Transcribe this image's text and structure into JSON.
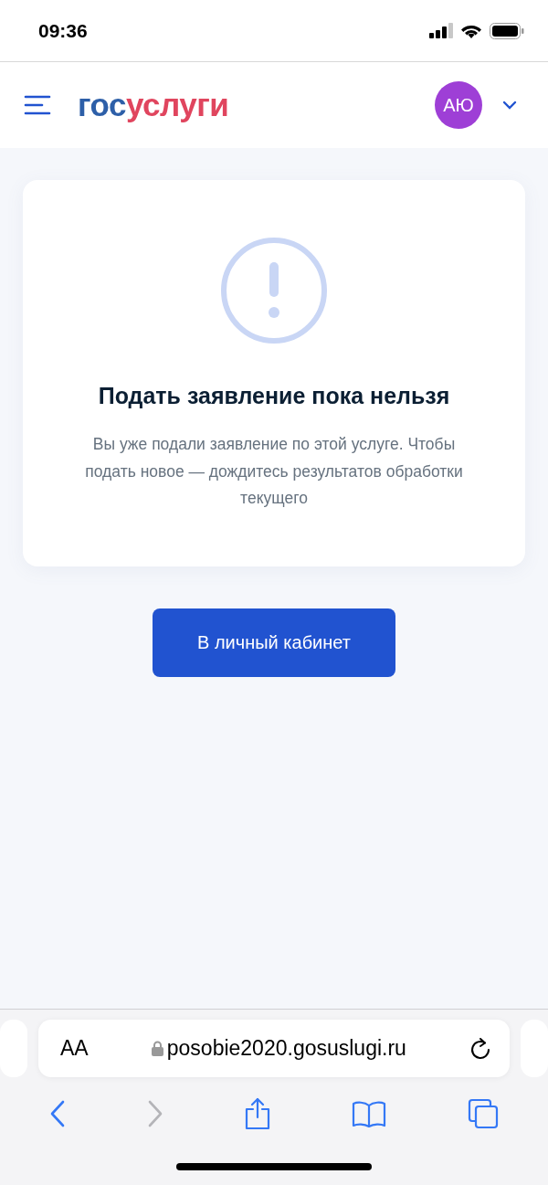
{
  "status_bar": {
    "time": "09:36"
  },
  "header": {
    "logo": {
      "part_1": "гос",
      "part_2": "услуги"
    },
    "avatar": "АЮ"
  },
  "card": {
    "title": "Подать заявление пока нельзя",
    "text": "Вы уже подали заявление по этой услуге. Чтобы подать новое — дождитесь результатов обработки текущего"
  },
  "button": "В личный кабинет",
  "browser": {
    "text_size": "AA",
    "url": "posobie2020.gosuslugi.ru",
    "back_disabled": false,
    "forward_disabled": true
  }
}
